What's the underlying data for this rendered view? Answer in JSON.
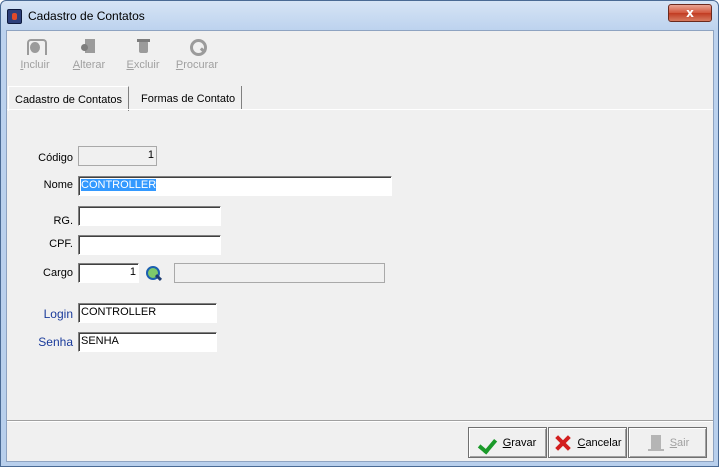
{
  "window": {
    "title": "Cadastro de Contatos",
    "close_glyph": "x"
  },
  "toolbar": {
    "buttons": [
      {
        "key": "I",
        "rest": "ncluir",
        "icon": "bug-icon"
      },
      {
        "key": "A",
        "rest": "lterar",
        "icon": "edit-doc-icon"
      },
      {
        "key": "E",
        "rest": "xcluir",
        "icon": "trash-icon"
      },
      {
        "key": "P",
        "rest": "rocurar",
        "icon": "search-icon"
      }
    ]
  },
  "tabs": [
    {
      "label": "Cadastro de Contatos",
      "active": true
    },
    {
      "label": "Formas de Contato",
      "active": false
    }
  ],
  "form": {
    "codigo": {
      "label": "Código",
      "value": "1"
    },
    "nome": {
      "label": "Nome",
      "value": "CONTROLLER"
    },
    "rg": {
      "label": "RG.",
      "value": ""
    },
    "cpf": {
      "label": "CPF.",
      "value": ""
    },
    "cargo": {
      "label": "Cargo",
      "value": "1",
      "description": ""
    },
    "login": {
      "label": "Login",
      "value": "CONTROLLER"
    },
    "senha": {
      "label": "Senha",
      "value": "SENHA"
    }
  },
  "buttons": {
    "gravar": {
      "key": "G",
      "rest": "ravar"
    },
    "cancelar": {
      "key": "C",
      "rest": "ancelar"
    },
    "sair": {
      "key": "S",
      "rest": "air"
    }
  },
  "colors": {
    "accent_label": "#1a3b9b",
    "selection": "#3399ff",
    "close_button": "#c13b22"
  }
}
